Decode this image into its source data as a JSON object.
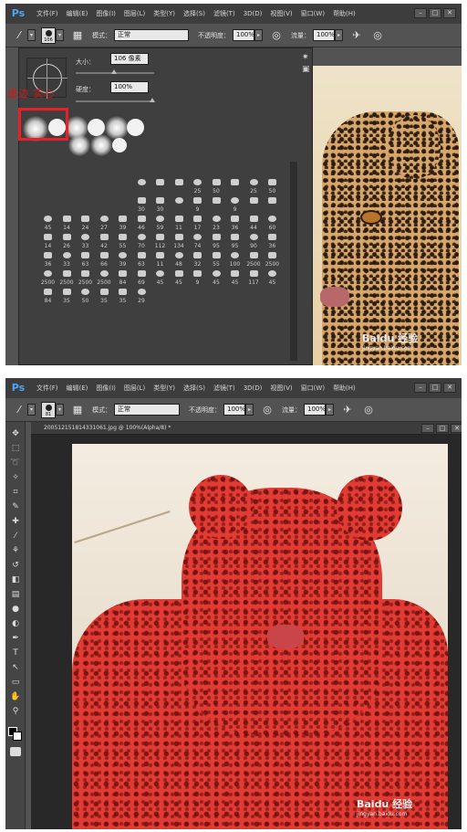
{
  "menu": {
    "logo": "Ps",
    "items": [
      "文件(F)",
      "编辑(E)",
      "图像(I)",
      "图层(L)",
      "类型(Y)",
      "选择(S)",
      "滤镜(T)",
      "3D(D)",
      "视图(V)",
      "窗口(W)",
      "帮助(H)"
    ],
    "window_buttons": [
      "–",
      "□",
      "✕"
    ]
  },
  "options_top": {
    "brush_size": "106",
    "mode_label": "模式：",
    "mode_value": "正常",
    "opacity_label": "不透明度：",
    "opacity_value": "100%",
    "flow_label": "流量：",
    "flow_value": "100%"
  },
  "picker": {
    "size_label": "大小：",
    "size_value": "106 像素",
    "hardness_label": "硬度：",
    "hardness_value": "100%",
    "annotation": "虚边  实心",
    "labels": [
      [
        "",
        "",
        "",
        "",
        "",
        "",
        "",
        "",
        "",
        "",
        "",
        "",
        ""
      ],
      [
        "",
        "",
        "",
        "",
        "",
        "",
        "",
        "",
        "25",
        "50",
        "",
        "25",
        "50"
      ],
      [
        "",
        "",
        "",
        "",
        "36",
        "30",
        "30",
        "",
        "9",
        "",
        "9",
        "",
        ""
      ],
      [
        "45",
        "14",
        "24",
        "27",
        "39",
        "46",
        "59",
        "11",
        "17",
        "23",
        "36",
        "44",
        "60"
      ],
      [
        "14",
        "26",
        "33",
        "42",
        "55",
        "70",
        "112",
        "134",
        "74",
        "95",
        "95",
        "90",
        "36"
      ],
      [
        "36",
        "33",
        "63",
        "66",
        "39",
        "63",
        "11",
        "48",
        "32",
        "55",
        "100",
        "2500",
        "2500"
      ],
      [
        "2500",
        "2500",
        "2500",
        "2500",
        "84",
        "69",
        "45",
        "45",
        "9",
        "45",
        "45",
        "117",
        "45"
      ],
      [
        "84",
        "35",
        "50",
        "35",
        "35",
        "29",
        "",
        "",
        "",
        "",
        "",
        "",
        ""
      ]
    ]
  },
  "watermark": {
    "brand": "Baidu 经验",
    "url": "jingyan.baidu.com"
  },
  "options_bottom": {
    "brush_size": "81",
    "mode_label": "模式：",
    "mode_value": "正常",
    "opacity_label": "不透明度：",
    "opacity_value": "100%",
    "flow_label": "流量：",
    "flow_value": "100%"
  },
  "document": {
    "tab_title": "200512151814331061.jpg @ 100%(Alpha/8) *"
  },
  "toolbox_icons": [
    "move-icon",
    "marquee-icon",
    "lasso-icon",
    "magic-wand-icon",
    "crop-icon",
    "eyedropper-icon",
    "healing-icon",
    "brush-icon",
    "stamp-icon",
    "history-brush-icon",
    "eraser-icon",
    "gradient-icon",
    "blur-icon",
    "dodge-icon",
    "pen-icon",
    "type-icon",
    "path-select-icon",
    "shape-icon",
    "hand-icon",
    "zoom-icon"
  ],
  "colors": {
    "mask_red": "#e23b33",
    "annotation_red": "#e8202a",
    "ps_blue": "#4fa4f6"
  }
}
